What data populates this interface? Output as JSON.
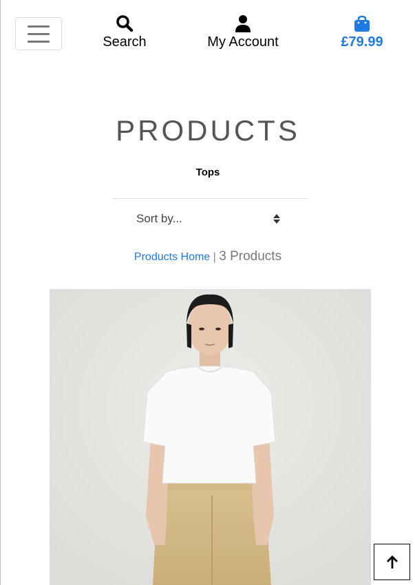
{
  "header": {
    "menu_toggle_icon": "hamburger-icon",
    "search": {
      "icon": "search-icon",
      "label": "Search"
    },
    "account": {
      "icon": "user-icon",
      "label": "My Account"
    },
    "bag": {
      "icon": "shopping-bag-icon",
      "total": "£79.99",
      "color": "#1e7be6"
    }
  },
  "page": {
    "title": "PRODUCTS",
    "category": "Tops"
  },
  "sort": {
    "selected": "Sort by..."
  },
  "results": {
    "home_link": "Products Home",
    "separator": "|",
    "count": "3 Products"
  },
  "product": {
    "image_subject": "model in white t-shirt and beige trousers"
  },
  "back_to_top": {
    "icon": "arrow-up-icon"
  }
}
